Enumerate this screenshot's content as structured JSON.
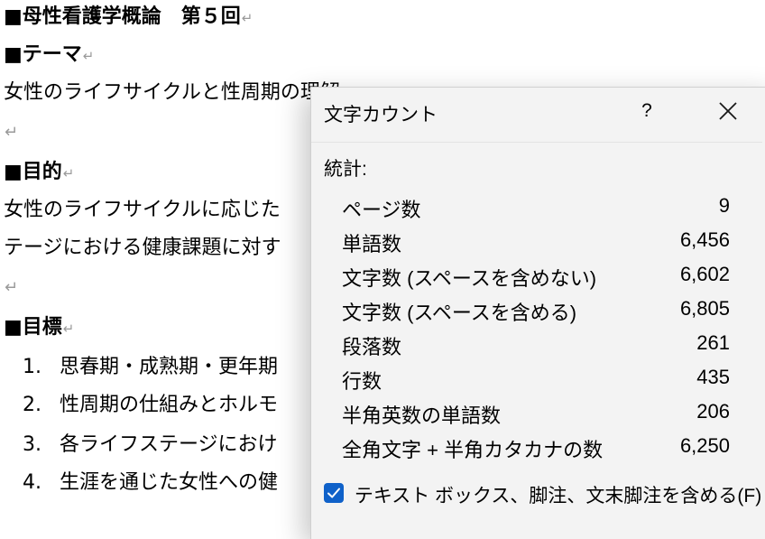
{
  "document": {
    "title": "■母性看護学概論　第５回",
    "theme_heading": "■テーマ",
    "theme_text": "女性のライフサイクルと性周期の理解",
    "purpose_heading": "■目的",
    "purpose_line1": "女性のライフサイクルに応じた",
    "purpose_line2": "テージにおける健康課題に対す",
    "goals_heading": "■目標",
    "goals": [
      {
        "num": "1.",
        "text": "思春期・成熟期・更年期"
      },
      {
        "num": "2.",
        "text": "性周期の仕組みとホルモ"
      },
      {
        "num": "3.",
        "text": "各ライフステージにおけ"
      },
      {
        "num": "4.",
        "text": "生涯を通じた女性への健"
      }
    ],
    "paragraph_mark": "↵"
  },
  "dialog": {
    "title": "文字カウント",
    "help_label": "?",
    "stats_label": "統計:",
    "stats": [
      {
        "label": "ページ数",
        "value": "9"
      },
      {
        "label": "単語数",
        "value": "6,456"
      },
      {
        "label": "文字数 (スペースを含めない)",
        "value": "6,602"
      },
      {
        "label": "文字数 (スペースを含める)",
        "value": "6,805"
      },
      {
        "label": "段落数",
        "value": "261"
      },
      {
        "label": "行数",
        "value": "435"
      },
      {
        "label": "半角英数の単語数",
        "value": "206"
      },
      {
        "label": "全角文字 + 半角カタカナの数",
        "value": "6,250"
      }
    ],
    "checkbox_label": "テキスト ボックス、脚注、文末脚注を含める(F)",
    "checkbox_checked": true,
    "accent_color": "#0f61c9"
  }
}
